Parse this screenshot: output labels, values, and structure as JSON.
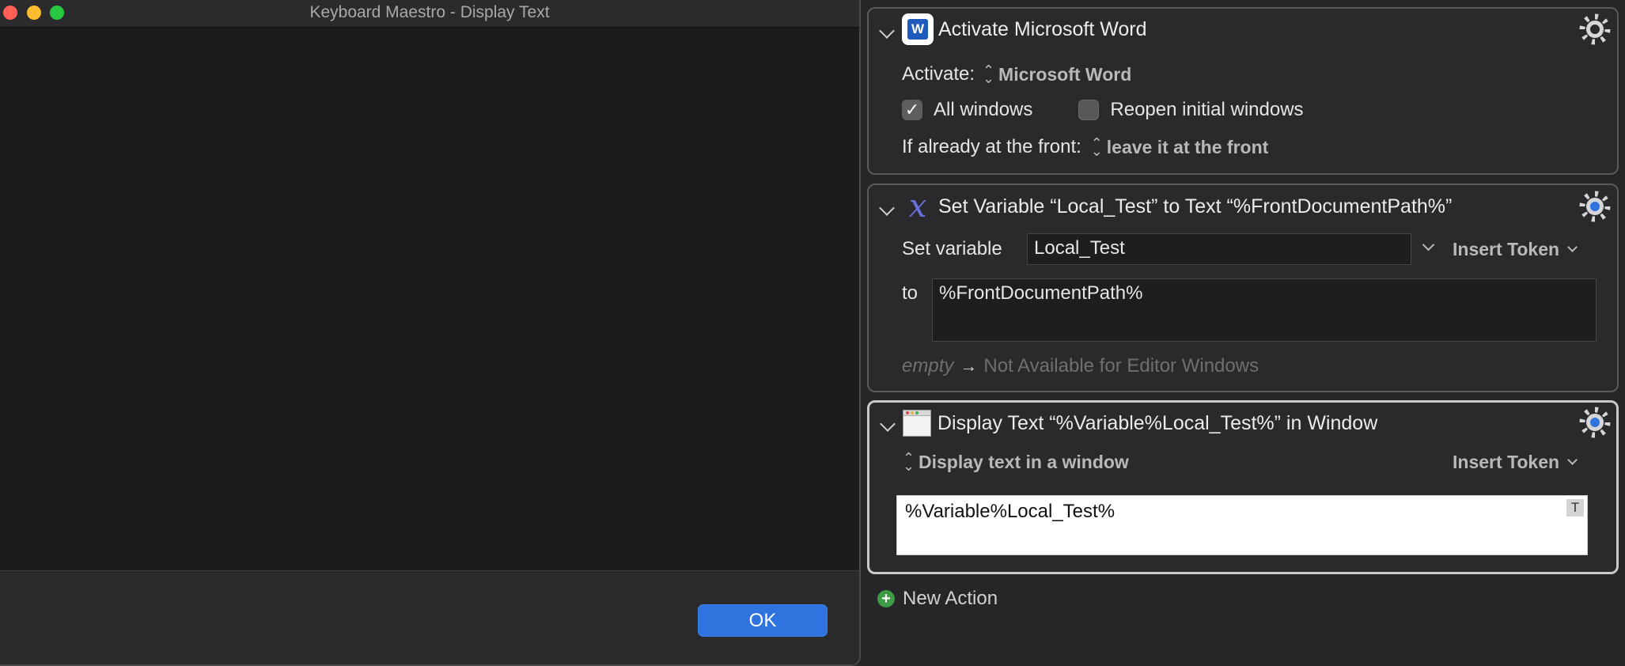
{
  "dialog": {
    "title": "Keyboard Maestro - Display Text",
    "ok_label": "OK"
  },
  "actions": [
    {
      "title": "Activate Microsoft Word",
      "icon": "microsoft-word-icon",
      "activate_label": "Activate:",
      "activate_value": "Microsoft Word",
      "all_windows_label": "All windows",
      "all_windows_checked": true,
      "reopen_label": "Reopen initial windows",
      "reopen_checked": false,
      "front_label": "If already at the front:",
      "front_value": "leave it at the front"
    },
    {
      "title": "Set Variable “Local_Test” to Text “%FrontDocumentPath%”",
      "icon": "variable-x-icon",
      "set_label": "Set variable",
      "var_value": "Local_Test",
      "insert_token": "Insert Token",
      "to_label": "to",
      "to_value": "%FrontDocumentPath%",
      "preview_empty": "empty",
      "preview_arrow": "→",
      "preview_text": "Not Available for Editor Windows"
    },
    {
      "title": "Display Text “%Variable%Local_Test%” in Window",
      "icon": "display-window-icon",
      "mode_value": "Display text in a window",
      "insert_token": "Insert Token",
      "text_value": "%Variable%Local_Test%",
      "token_badge": "T"
    }
  ],
  "new_action_label": "New Action",
  "colors": {
    "accent": "#2f74de",
    "add": "#3f9a45"
  }
}
